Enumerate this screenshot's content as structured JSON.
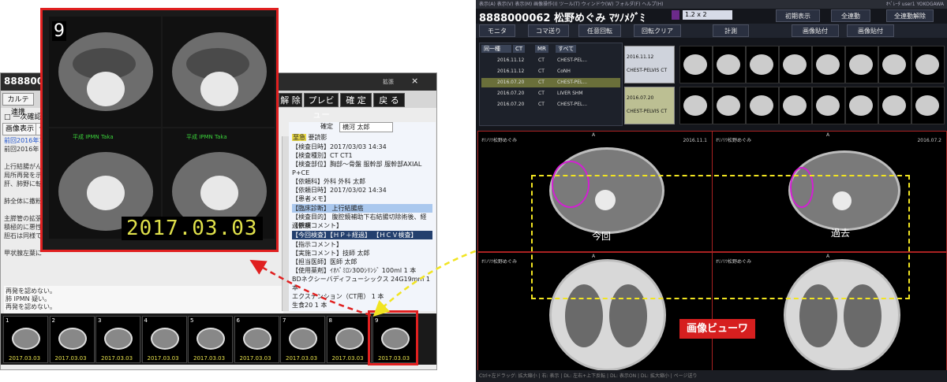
{
  "report_window": {
    "title": "8888000",
    "ext_label": "拡張",
    "close": "×",
    "toolbar_buttons": [
      "カルテ連携",
      "解 除",
      "プレビュー",
      "確 定",
      "戻 る"
    ],
    "sub_checkbox": "□ 一次確認",
    "tabs": [
      "画像表示",
      "テ"
    ],
    "left_text": [
      {
        "text": "前回2016年1",
        "link": true
      },
      {
        "text": "前回2016年",
        "link": false
      },
      {
        "text": "",
        "link": false
      },
      {
        "text": "上行結腸がん",
        "link": false
      },
      {
        "text": "局所再発を示",
        "link": false
      },
      {
        "text": "肝、肺野に転",
        "link": false
      },
      {
        "text": "",
        "link": false
      },
      {
        "text": "肺全体に撒粉",
        "link": false
      },
      {
        "text": "",
        "link": false
      },
      {
        "text": "主膵管の拡張",
        "link": false
      },
      {
        "text": "積極的に悪性",
        "link": false
      },
      {
        "text": "胆石は同様で",
        "link": false
      },
      {
        "text": "",
        "link": false
      },
      {
        "text": "甲状腺左葉に",
        "link": false
      }
    ],
    "lower_text": [
      "再発を認めない。",
      "肺 IPMN 疑い。",
      "再発を認めない。",
      "肺 IPMN 疑い。"
    ],
    "right_panel": {
      "confirm_label": "確定",
      "confirm_doctor": "横河 太郎",
      "badge": "至急",
      "badge_text": "要読影",
      "fields": [
        "【検査日時】2017/03/03  14:34",
        "【検査種別】CT  CT1",
        "【検査部位】胸部～骨盤  服幹部  服幹部AXIAL  P+CE",
        "【依頼科】外科  外科  太郎",
        "【依頼日時】2017/03/02  14:34",
        "【患者メモ】"
      ],
      "diag_header": "【臨床診断】  上行結腸癌",
      "purpose": "【検査目的】  腹腔鏡補助下右結腸切除術後、経過観察",
      "comment_header": "【依頼コメント】",
      "nav_row": "【今回検査】【ＨＰ＋経過】  【ＨＣＶ検査】",
      "instructions": [
        "【指示コメント】",
        "【実施コメント】技師  太郎",
        "【担当医師】医師  太郎",
        "【使用薬剤】ｲｵﾊﾟﾐﾛﾝ300ｼﾘﾝｼﾞ 100ml 1 本",
        "BDネクシーバディフューシックス  24G19mm 1 本",
        "エクステンション（CT用）  1 本",
        "生食20 1 本"
      ]
    },
    "thumbnails": [
      {
        "num": "1",
        "date": "2017.03.03"
      },
      {
        "num": "2",
        "date": "2017.03.03"
      },
      {
        "num": "3",
        "date": "2017.03.03"
      },
      {
        "num": "4",
        "date": "2017.03.03"
      },
      {
        "num": "5",
        "date": "2017.03.03"
      },
      {
        "num": "6",
        "date": "2017.03.03"
      },
      {
        "num": "7",
        "date": "2017.03.03"
      },
      {
        "num": "8",
        "date": "2017.03.03"
      },
      {
        "num": "9",
        "date": "2017.03.03"
      }
    ]
  },
  "zoom_panel": {
    "number": "9",
    "date": "2017.03.03",
    "green_labels": [
      "平成 IPMN Taka",
      "平成 IPMN Taka",
      "平成 IPMN Taka",
      "平成 IPMN Taka"
    ]
  },
  "viewer": {
    "menu_text": "表示(A) 表示(V) 表示(M) 画像操作(I) ツール(T) ウィンドウ(W) フォルダ(F) ヘルプ(H)",
    "user": "ｵﾍﾟﾚｰﾀ user1  YOKOGAWA",
    "title": "8888000062 松野めぐみ ﾏﾂﾉﾒｸﾞﾐ",
    "layout_value": "1.2 x 2",
    "header_buttons": [
      "初期表示",
      "全連動",
      "全連動解除"
    ],
    "toolbar": [
      "モニタ",
      "コマ送り",
      "任意回転",
      "回転クリア",
      "計測",
      "画像貼付",
      "画像貼付"
    ],
    "list_tabs": [
      "同一種",
      "CT",
      "MR",
      "すべて"
    ],
    "list_rows": [
      {
        "date": "2016.11.12",
        "mod": "CT",
        "desc": "CHEST-PEL..."
      },
      {
        "date": "2016.11.12",
        "mod": "CT",
        "desc": "CoNH"
      },
      {
        "date": "2016.07.20",
        "mod": "CT",
        "desc": "CHEST-PEL..."
      },
      {
        "date": "2016.07.20",
        "mod": "CT",
        "desc": "LIVER SHM"
      },
      {
        "date": "2016.07.20",
        "mod": "CT",
        "desc": "CHEST-PEL..."
      }
    ],
    "series_cards": [
      {
        "date": "2016.11.12",
        "desc": "CHEST-PELVIS CT"
      },
      {
        "date": "2016.07.20",
        "desc": "CHEST-PELVIS CT"
      }
    ],
    "panes": [
      {
        "name": "ｵﾘﾉﾘﾂ松野めぐみ",
        "date": "2016.11.1",
        "caption": "今回",
        "corner": "A",
        "dose": "1.3mm",
        "kv": "120kV"
      },
      {
        "name": "ｵﾘﾉﾘﾂ松野めぐみ",
        "date": "2016.07.2",
        "caption": "過去",
        "corner": "A",
        "dose": "1.3mm",
        "kv": "120kV"
      },
      {
        "name": "ｵﾘﾉﾘﾂ松野めぐみ",
        "date": "2016.11.1",
        "caption": "",
        "corner": "A",
        "dose": "5.0mm",
        "kv": "120kV"
      },
      {
        "name": "ｵﾘﾉﾘﾂ松野めぐみ",
        "date": "2016.07.2",
        "caption": "",
        "corner": "A",
        "dose": "5.0mm",
        "kv": "120kV"
      }
    ],
    "label": "画像ビューワ",
    "status": "Ctrl+左ドラッグ: 拡大縮小 | 右: 表示 | DL: 左右+上下反転 | DL: 表示ON | DL: 拡大縮小 | ページ送り"
  },
  "colors": {
    "highlight_red": "#e02020",
    "arrow_yellow": "#f1e421",
    "circle_magenta": "#d31fd3"
  }
}
